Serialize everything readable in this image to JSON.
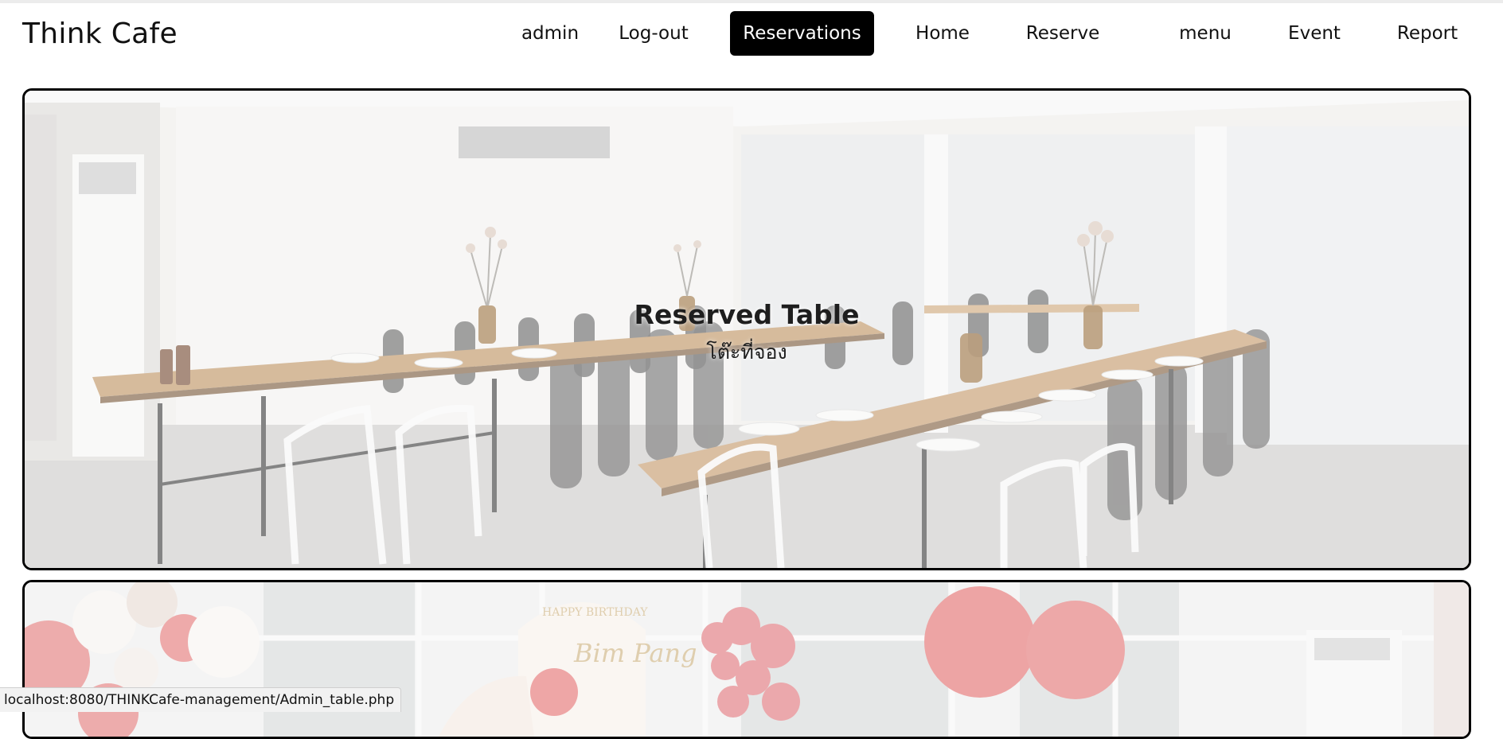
{
  "brand": "Think Cafe",
  "nav": {
    "admin": "admin",
    "logout": "Log-out",
    "reservations": "Reservations",
    "home": "Home",
    "reserve": "Reserve",
    "menu": "menu",
    "event": "Event",
    "report": "Report"
  },
  "cards": [
    {
      "title": "Reserved Table",
      "subtitle": "โต๊ะที่จอง"
    }
  ],
  "event_banner": {
    "sign_text": "HAPPY BIRTHDAY",
    "sign_script": "Bim Pang"
  },
  "status_url": "localhost:8080/THINKCafe-management/Admin_table.php"
}
